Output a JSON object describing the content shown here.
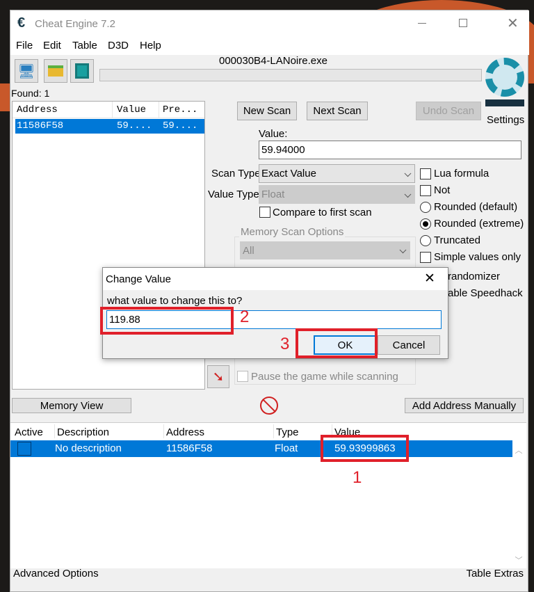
{
  "window": {
    "title": "Cheat Engine 7.2",
    "process": "000030B4-LANoire.exe"
  },
  "menu": [
    "File",
    "Edit",
    "Table",
    "D3D",
    "Help"
  ],
  "found": "Found: 1",
  "scan_list": {
    "headers": [
      "Address",
      "Value",
      "Pre..."
    ],
    "rows": [
      [
        "11586F58",
        "59....",
        "59...."
      ]
    ]
  },
  "buttons": {
    "new_scan": "New Scan",
    "next_scan": "Next Scan",
    "undo_scan": "Undo Scan",
    "settings": "Settings",
    "memory_view": "Memory View",
    "add_address": "Add Address Manually"
  },
  "value_label": "Value:",
  "value_input": "59.94000",
  "scan_type": {
    "label": "Scan Type",
    "value": "Exact Value"
  },
  "value_type": {
    "label": "Value Type",
    "value": "Float"
  },
  "compare_first": "Compare to first scan",
  "options": [
    {
      "label": "Lua formula",
      "kind": "checkbox",
      "checked": false
    },
    {
      "label": "Not",
      "kind": "checkbox",
      "checked": false
    },
    {
      "label": "Rounded (default)",
      "kind": "radio",
      "checked": false
    },
    {
      "label": "Rounded (extreme)",
      "kind": "radio",
      "checked": true
    },
    {
      "label": "Truncated",
      "kind": "radio",
      "checked": false
    },
    {
      "label": "Simple values only",
      "kind": "checkbox",
      "checked": false
    }
  ],
  "partial_options": [
    "randomizer",
    "able Speedhack"
  ],
  "memory_scan": {
    "title": "Memory Scan Options",
    "region": "All",
    "pause": "Pause the game while scanning"
  },
  "dialog": {
    "title": "Change Value",
    "prompt": "what value to change this to?",
    "input": "119.88",
    "ok": "OK",
    "cancel": "Cancel"
  },
  "annotations": [
    "1",
    "2",
    "3"
  ],
  "address_table": {
    "headers": [
      "Active",
      "Description",
      "Address",
      "Type",
      "Value"
    ],
    "rows": [
      {
        "description": "No description",
        "address": "11586F58",
        "type": "Float",
        "value": "59.93999863"
      }
    ]
  },
  "status": {
    "left": "Advanced Options",
    "right": "Table Extras"
  },
  "colors": {
    "selection": "#0078d7",
    "annotation": "#e0202a",
    "logo": "#1a8fa8"
  }
}
